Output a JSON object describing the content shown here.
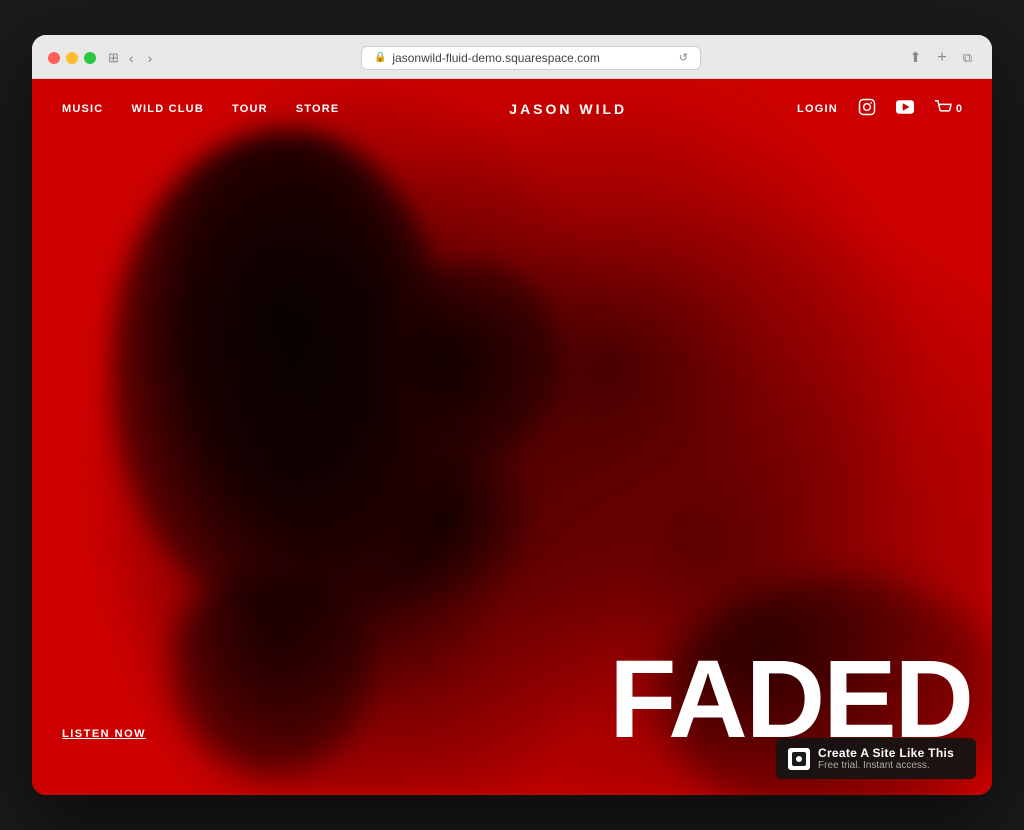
{
  "browser": {
    "url": "jasonwild-fluid-demo.squarespace.com",
    "reload_label": "↺"
  },
  "nav": {
    "music_label": "MUSIC",
    "wildclub_label": "WILD CLUB",
    "tour_label": "TOUR",
    "store_label": "STORE",
    "site_title": "JASON WILD",
    "login_label": "LOGIN",
    "cart_count": "0"
  },
  "hero": {
    "headline": "FADED",
    "cta_label": "LISTEN NOW"
  },
  "badge": {
    "title": "Create A Site Like This",
    "subtitle": "Free trial. Instant access."
  }
}
